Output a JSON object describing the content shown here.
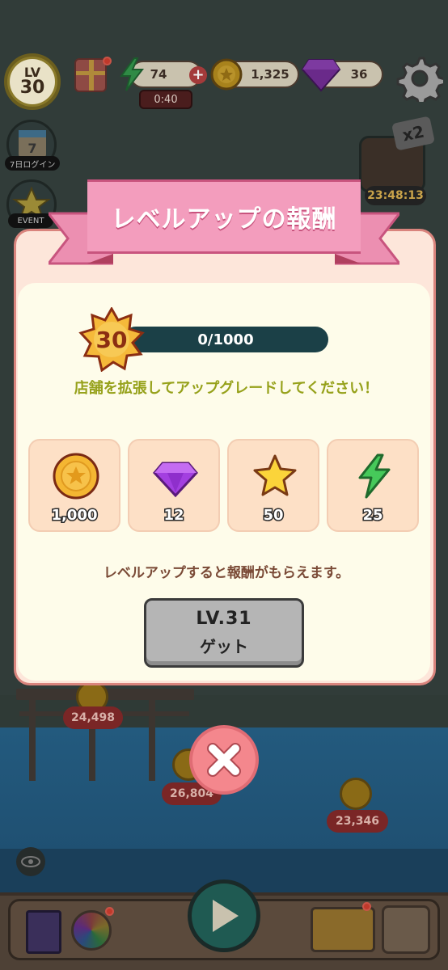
{
  "hud": {
    "level_label": "LV",
    "level_value": "30",
    "energy": "74",
    "energy_timer": "0:40",
    "coins": "1,325",
    "gems": "36"
  },
  "side": {
    "login_label": "7日ログイン",
    "login_day": "7",
    "event_label": "EVENT",
    "chest_badge": "x2",
    "chest_timer": "23:48:13"
  },
  "background": {
    "pier_values": [
      "24,498",
      "26,804",
      "23,346"
    ]
  },
  "modal": {
    "title": "レベルアップの報酬",
    "level": "30",
    "progress_text": "0/1000",
    "progress_fraction": 0,
    "hint": "店舗を拡張してアップグレードしてください！",
    "rewards": [
      {
        "icon": "coin-icon",
        "value": "1,000"
      },
      {
        "icon": "gem-icon",
        "value": "12"
      },
      {
        "icon": "star-icon",
        "value": "50"
      },
      {
        "icon": "energy-icon",
        "value": "25"
      }
    ],
    "note": "レベルアップすると報酬がもらえます。",
    "claim_level": "LV.31",
    "claim_label": "ゲット"
  },
  "colors": {
    "ribbon": "#f39dbd",
    "panel": "#fde6da",
    "inner": "#fefcea",
    "hint": "#96a11a",
    "close": "#f4878d"
  }
}
